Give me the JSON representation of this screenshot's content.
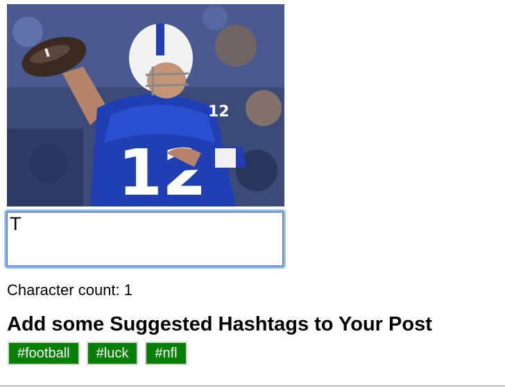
{
  "post": {
    "input_value": "T",
    "char_count_label": "Character count:",
    "char_count_value": "1"
  },
  "hashtags": {
    "heading": "Add some Suggested Hashtags to Your Post",
    "items": [
      "#football",
      "#luck",
      "#nfl"
    ],
    "button_color": "#088008"
  }
}
